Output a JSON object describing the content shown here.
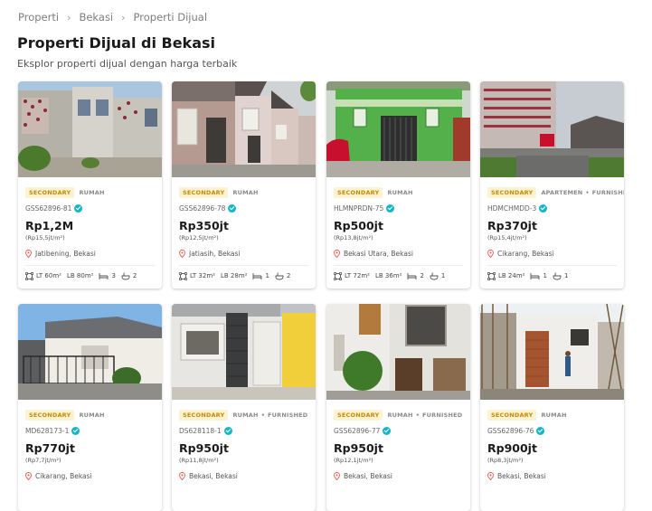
{
  "breadcrumb": [
    "Properti",
    "Bekasi",
    "Properti Dijual"
  ],
  "page_title": "Properti Dijual di Bekasi",
  "subtitle": "Eksplor properti dijual dengan harga terbaik",
  "colors": {
    "badge_bg": "#fdf3d3",
    "badge_text": "#c48a00",
    "verified": "#19b4c4",
    "pin": "#e05a4f"
  },
  "listings": [
    {
      "badge": "SECONDARY",
      "type": "RUMAH",
      "code": "GSS62896-81",
      "price": "Rp1,2M",
      "per_m2": "(Rp15,5jt/m²)",
      "location": "Jatibening, Bekasi",
      "specs": [
        "LT 60m²",
        "LB 80m²"
      ],
      "bedrooms": "3",
      "bathrooms": "2"
    },
    {
      "badge": "SECONDARY",
      "type": "RUMAH",
      "code": "GSS62896-78",
      "price": "Rp350jt",
      "per_m2": "(Rp12,5jt/m²)",
      "location": "Jatiasih, Bekasi",
      "specs": [
        "LT 32m²",
        "LB 28m²"
      ],
      "bedrooms": "1",
      "bathrooms": "2"
    },
    {
      "badge": "SECONDARY",
      "type": "RUMAH",
      "code": "HLMNPRDN-75",
      "price": "Rp500jt",
      "per_m2": "(Rp13,8jt/m²)",
      "location": "Bekasi Utara, Bekasi",
      "specs": [
        "LT 72m²",
        "LB 36m²"
      ],
      "bedrooms": "2",
      "bathrooms": "1"
    },
    {
      "badge": "SECONDARY",
      "type": "APARTEMEN",
      "extra": "FURNISHED",
      "code": "HDMCHMDD-3",
      "price": "Rp370jt",
      "per_m2": "(Rp15,4jt/m²)",
      "location": "Cikarang, Bekasi",
      "specs": [
        "LB 24m²"
      ],
      "bedrooms": "1",
      "bathrooms": "1"
    },
    {
      "badge": "SECONDARY",
      "type": "RUMAH",
      "code": "MD628173-1",
      "price": "Rp770jt",
      "per_m2": "(Rp7,7jt/m²)",
      "location": "Cikarang, Bekasi"
    },
    {
      "badge": "SECONDARY",
      "type": "RUMAH",
      "extra": "FURNISHED",
      "code": "DS628118-1",
      "price": "Rp950jt",
      "per_m2": "(Rp11,8jt/m²)",
      "location": "Bekasi, Bekasi"
    },
    {
      "badge": "SECONDARY",
      "type": "RUMAH",
      "extra": "FURNISHED",
      "code": "GSS62896-77",
      "price": "Rp950jt",
      "per_m2": "(Rp12,1jt/m²)",
      "location": "Bekasi, Bekasi"
    },
    {
      "badge": "SECONDARY",
      "type": "RUMAH",
      "code": "GSS62896-76",
      "price": "Rp900jt",
      "per_m2": "(Rp8,3jt/m²)",
      "location": "Bekasi, Bekasi"
    }
  ]
}
